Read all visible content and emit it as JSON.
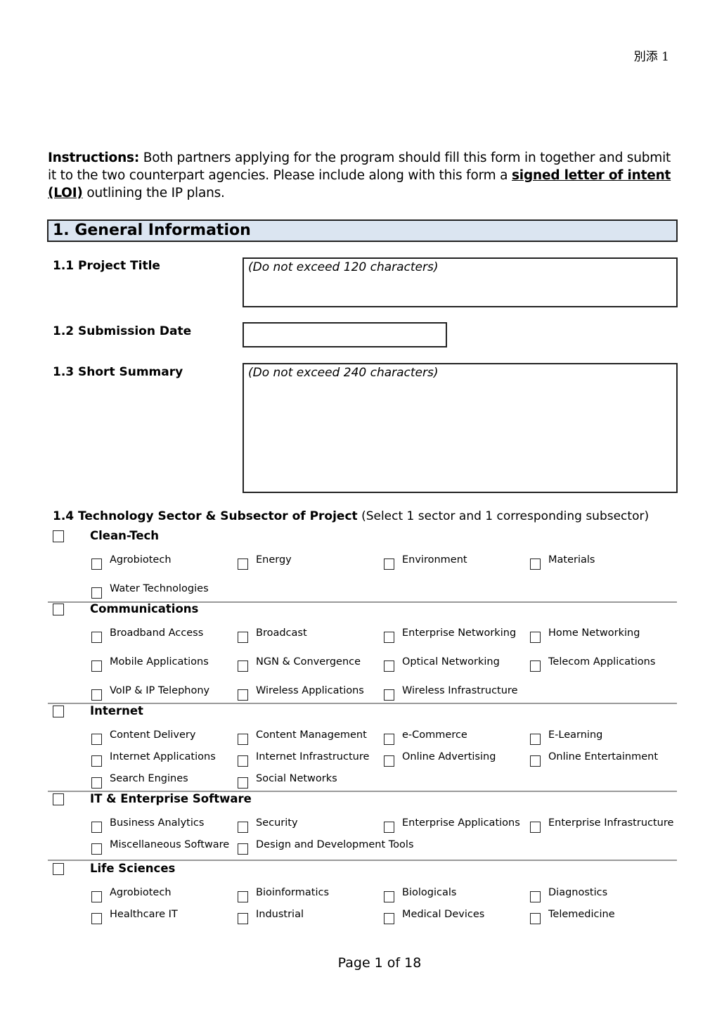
{
  "attachment_label": "別添 1",
  "instructions": {
    "lead": "Instructions:",
    "text_1": " Both partners applying for the program should fill this form in together and submit it to the two counterpart agencies. Please include along with this form a ",
    "emphasis": "signed letter of intent (LOI)",
    "text_2": " outlining the IP plans."
  },
  "section": {
    "title": "1.  General Information"
  },
  "fields": {
    "project_title": {
      "label": "1.1  Project Title",
      "hint": "(Do not exceed 120 characters)",
      "value": ""
    },
    "submission_date": {
      "label": "1.2  Submission Date",
      "value": ""
    },
    "short_summary": {
      "label": "1.3  Short Summary",
      "hint": "(Do not exceed 240 characters)",
      "value": ""
    }
  },
  "technology": {
    "heading": "1.4 Technology Sector & Subsector of Project",
    "note": " (Select 1 sector and 1 corresponding subsector)",
    "sectors": [
      {
        "name": "Clean-Tech",
        "checked": false,
        "subsectors": [
          "Agrobiotech",
          "Energy",
          "Environment",
          "Materials",
          "Water Technologies"
        ]
      },
      {
        "name": "Communications",
        "checked": false,
        "subsectors": [
          "Broadband Access",
          "Broadcast",
          "Enterprise Networking",
          "Home Networking",
          "Mobile Applications",
          "NGN & Convergence",
          "Optical Networking",
          "Telecom Applications",
          "VoIP & IP Telephony",
          "Wireless Applications",
          "Wireless Infrastructure"
        ]
      },
      {
        "name": "Internet",
        "checked": false,
        "subsectors": [
          "Content Delivery",
          "Content Management",
          "e-Commerce",
          "E-Learning",
          "Internet Applications",
          "Internet Infrastructure",
          "Online Advertising",
          "Online Entertainment",
          "Search Engines",
          "Social Networks"
        ]
      },
      {
        "name": "IT & Enterprise Software",
        "checked": false,
        "subsectors": [
          "Business Analytics",
          "Security",
          "Enterprise Applications",
          "Enterprise Infrastructure",
          "Miscellaneous Software",
          "Design and Development Tools"
        ]
      },
      {
        "name": "Life Sciences",
        "checked": false,
        "subsectors": [
          "Agrobiotech",
          "Bioinformatics",
          "Biologicals",
          "Diagnostics",
          "Healthcare IT",
          "Industrial",
          "Medical Devices",
          "Telemedicine"
        ]
      }
    ]
  },
  "footer": {
    "page_label": "Page 1 of 18"
  }
}
